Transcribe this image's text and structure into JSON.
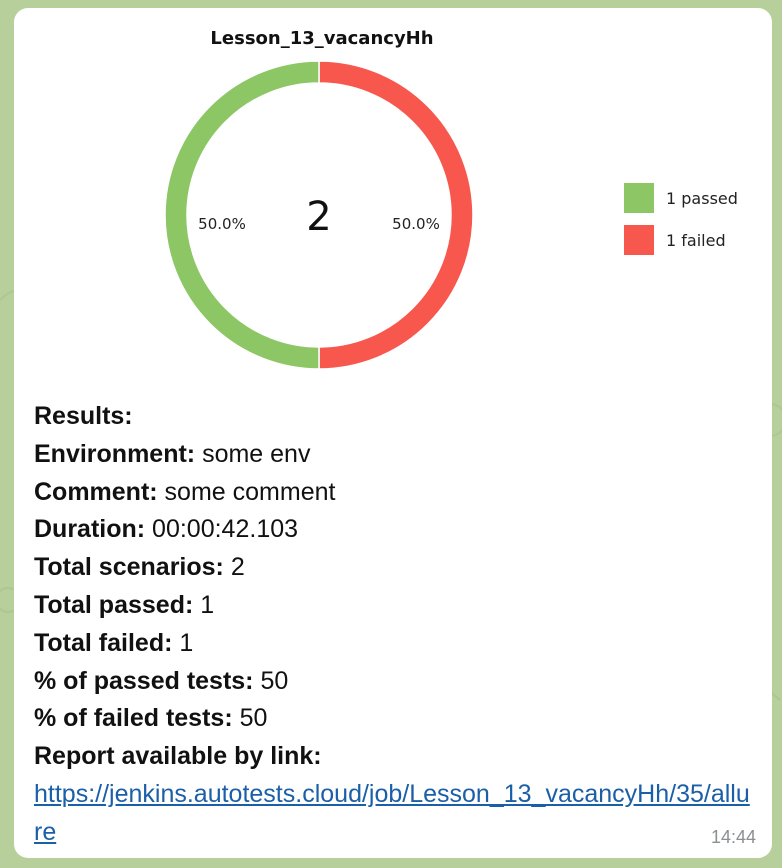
{
  "chart_data": {
    "type": "pie",
    "title": "Lesson_13_vacancyHh",
    "total_label": "2",
    "slices": [
      {
        "label": "1 passed",
        "value": 1,
        "percent_label": "50.0%",
        "color": "#8cc665"
      },
      {
        "label": "1 failed",
        "value": 1,
        "percent_label": "50.0%",
        "color": "#f7574d"
      }
    ],
    "legend_placement": "right"
  },
  "message": {
    "lines": [
      {
        "key": "Results:",
        "value": ""
      },
      {
        "key": "Environment:",
        "value": " some env"
      },
      {
        "key": "Comment:",
        "value": " some comment"
      },
      {
        "key": "Duration:",
        "value": " 00:00:42.103"
      },
      {
        "key": "Total scenarios:",
        "value": " 2"
      },
      {
        "key": "Total passed:",
        "value": " 1"
      },
      {
        "key": "Total failed:",
        "value": " 1"
      },
      {
        "key": "% of passed tests:",
        "value": " 50"
      },
      {
        "key": "% of failed tests:",
        "value": " 50"
      },
      {
        "key": "Report available by link:",
        "value": ""
      }
    ],
    "link": "https://jenkins.autotests.cloud/job/Lesson_13_vacancyHh/35/allure",
    "time": "14:44"
  },
  "colors": {
    "wallpaper": "#b7cf9a",
    "bubble": "#ffffff",
    "link": "#1a5fa8"
  }
}
